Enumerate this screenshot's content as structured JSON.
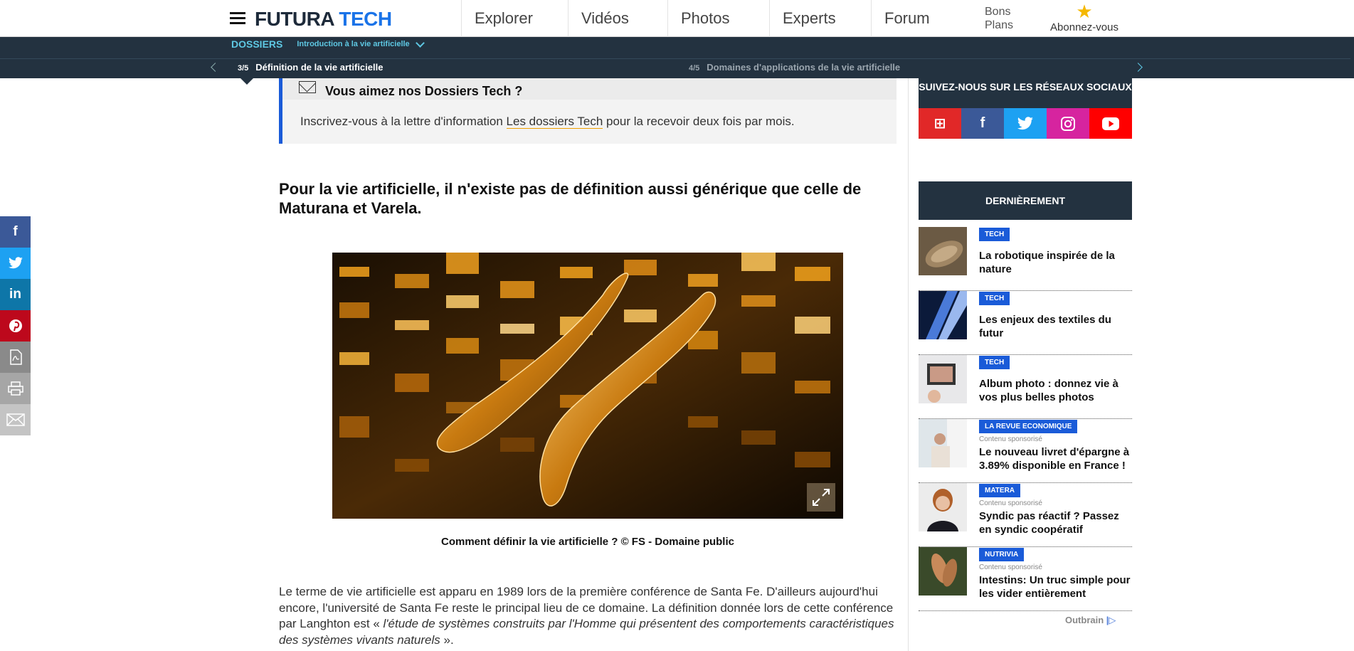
{
  "header": {
    "logo_part1": "FUTURA",
    "logo_part2": "TECH",
    "nav": [
      "Explorer",
      "Vidéos",
      "Photos",
      "Experts",
      "Forum"
    ],
    "bons_line1": "Bons",
    "bons_line2": "Plans",
    "abonnez": "Abonnez-vous",
    "star_icon": "star-icon"
  },
  "dossier": {
    "label": "DOSSIERS",
    "title": "Introduction à la vie artificielle",
    "current_num": "3/5",
    "current_title": "Définition de la vie artificielle",
    "next_num": "4/5",
    "next_title": "Domaines d'applications de la vie artificielle"
  },
  "newsletter": {
    "title": "Vous aimez nos Dossiers Tech ?",
    "text_before": "Inscrivez-vous à la lettre d'information ",
    "link": "Les dossiers Tech",
    "text_after": " pour la recevoir deux fois par mois."
  },
  "article": {
    "lead": "Pour la vie artificielle, il n'existe pas de définition aussi générique que celle de Maturana et Varela.",
    "caption": "Comment définir la vie artificielle ? © FS - Domaine public",
    "body_plain": "Le terme de vie artificielle est apparu en 1989 lors de la première conférence de Santa Fe. D'ailleurs aujourd'hui encore, l'université de Santa Fe reste le principal lieu de ce domaine. La définition donnée lors de cette conférence par Langhton est « ",
    "body_italic": "l'étude de systèmes construits par l'Homme qui présentent des comportements caractéristiques des systèmes vivants naturels",
    "body_end": " »."
  },
  "sidebar": {
    "social_title": "SUIVEZ-NOUS SUR LES RÉSEAUX SOCIAUX",
    "social": [
      {
        "icon": "flipboard-icon",
        "glyph": "⊞",
        "color": "#e12828"
      },
      {
        "icon": "facebook-icon",
        "glyph": "f",
        "color": "#3b5998"
      },
      {
        "icon": "twitter-icon",
        "glyph": "🐦",
        "color": "#1da1f2"
      },
      {
        "icon": "instagram-icon",
        "glyph": "◎",
        "color": "#d6249f"
      },
      {
        "icon": "youtube-icon",
        "glyph": "▶",
        "color": "#ff0000"
      }
    ],
    "dern_title": "DERNIÈREMENT",
    "items": [
      {
        "tag": "TECH",
        "sponsored": "",
        "title": "La robotique inspirée de la nature"
      },
      {
        "tag": "TECH",
        "sponsored": "",
        "title": "Les enjeux des textiles du futur"
      },
      {
        "tag": "TECH",
        "sponsored": "",
        "title": "Album photo : donnez vie à vos plus belles photos"
      },
      {
        "tag": "LA REVUE ECONOMIQUE",
        "sponsored": "Contenu sponsorisé",
        "title": "Le nouveau livret d'épargne à 3.89% disponible en France !"
      },
      {
        "tag": "MATERA",
        "sponsored": "Contenu sponsorisé",
        "title": "Syndic pas réactif ? Passez en syndic coopératif"
      },
      {
        "tag": "NUTRIVIA",
        "sponsored": "Contenu sponsorisé",
        "title": "Intestins: Un truc simple pour les vider entièrement"
      }
    ],
    "outbrain": "Outbrain"
  },
  "share": [
    {
      "icon": "facebook-icon",
      "glyph": "f",
      "color": "#3b5998"
    },
    {
      "icon": "twitter-icon",
      "glyph": "🐦",
      "color": "#1da1f2"
    },
    {
      "icon": "linkedin-icon",
      "glyph": "in",
      "color": "#0e76a8"
    },
    {
      "icon": "pinterest-icon",
      "glyph": "P",
      "color": "#bd081c"
    },
    {
      "icon": "pdf-icon",
      "glyph": "⎘",
      "color": "#8a8a8a"
    },
    {
      "icon": "print-icon",
      "glyph": "⎙",
      "color": "#a6a6a6"
    },
    {
      "icon": "mail-icon",
      "glyph": "✉",
      "color": "#c4c4c4"
    }
  ]
}
